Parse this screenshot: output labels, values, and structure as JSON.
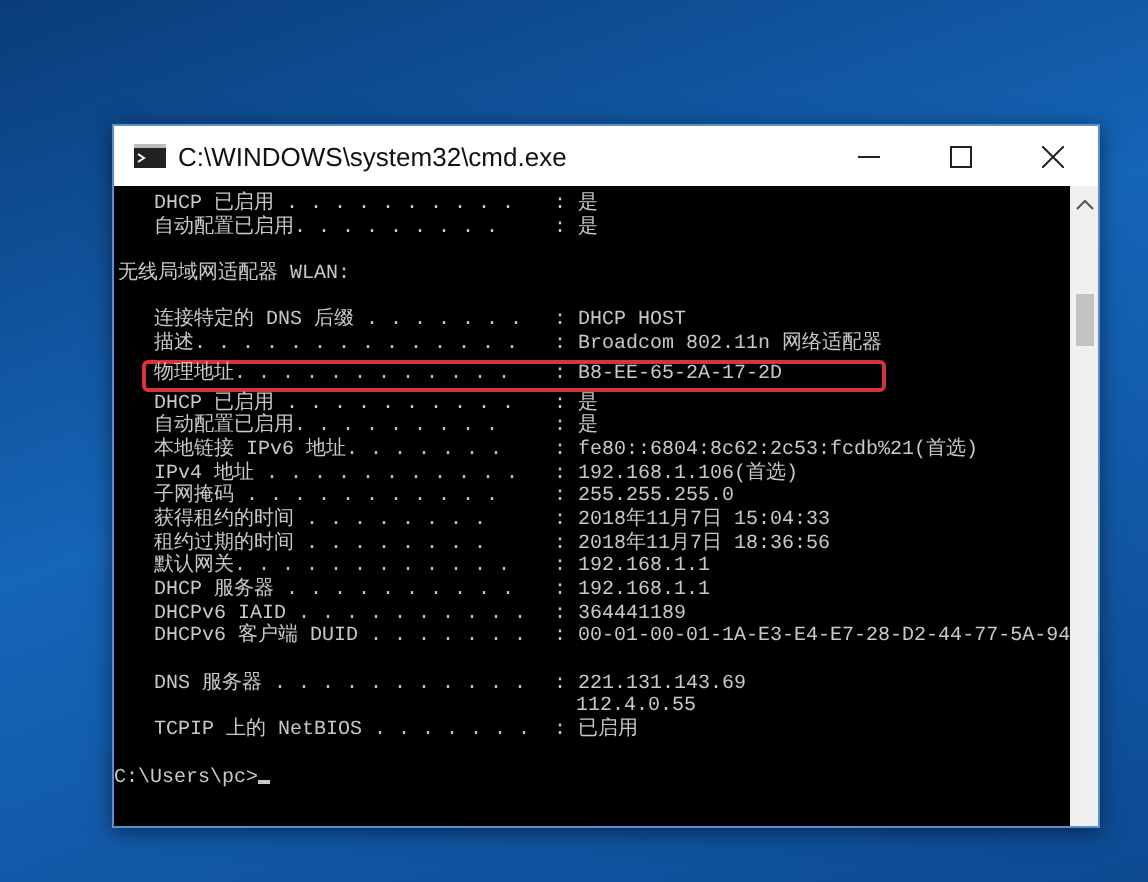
{
  "window": {
    "title": "C:\\WINDOWS\\system32\\cmd.exe"
  },
  "console": {
    "lines": [
      {
        "kind": "entry",
        "label": "DHCP 已启用 . . . . . . . . . .",
        "separator": ":",
        "value": "是"
      },
      {
        "kind": "entry",
        "label": "自动配置已启用. . . . . . . . .",
        "separator": ":",
        "value": "是"
      },
      {
        "kind": "blank"
      },
      {
        "kind": "heading",
        "text": "无线局域网适配器 WLAN:"
      },
      {
        "kind": "blank"
      },
      {
        "kind": "entry",
        "label": "连接特定的 DNS 后缀 . . . . . . .",
        "separator": ":",
        "value": "DHCP HOST"
      },
      {
        "kind": "entry",
        "label": "描述. . . . . . . . . . . . . .",
        "separator": ":",
        "value": "Broadcom 802.11n 网络适配器"
      },
      {
        "kind": "entry",
        "label": "物理地址. . . . . . . . . . . .",
        "separator": ":",
        "value": "B8-EE-65-2A-17-2D",
        "highlighted": true
      },
      {
        "kind": "entry",
        "label": "DHCP 已启用 . . . . . . . . . .",
        "separator": ":",
        "value": "是"
      },
      {
        "kind": "entry",
        "label": "自动配置已启用. . . . . . . . .",
        "separator": ":",
        "value": "是"
      },
      {
        "kind": "entry",
        "label": "本地链接 IPv6 地址. . . . . . .",
        "separator": ":",
        "value": "fe80::6804:8c62:2c53:fcdb%21(首选)"
      },
      {
        "kind": "entry",
        "label": "IPv4 地址 . . . . . . . . . . .",
        "separator": ":",
        "value": "192.168.1.106(首选)"
      },
      {
        "kind": "entry",
        "label": "子网掩码 . . . . . . . . . . .",
        "separator": ":",
        "value": "255.255.255.0"
      },
      {
        "kind": "entry",
        "label": "获得租约的时间 . . . . . . . .",
        "separator": ":",
        "value": "2018年11月7日 15:04:33"
      },
      {
        "kind": "entry",
        "label": "租约过期的时间 . . . . . . . .",
        "separator": ":",
        "value": "2018年11月7日 18:36:56"
      },
      {
        "kind": "entry",
        "label": "默认网关. . . . . . . . . . . .",
        "separator": ":",
        "value": "192.168.1.1"
      },
      {
        "kind": "entry",
        "label": "DHCP 服务器 . . . . . . . . . .",
        "separator": ":",
        "value": "192.168.1.1"
      },
      {
        "kind": "entry",
        "label": "DHCPv6 IAID . . . . . . . . . .",
        "separator": ":",
        "value": "364441189"
      },
      {
        "kind": "entry",
        "label": "DHCPv6 客户端 DUID . . . . . . .",
        "separator": ":",
        "value": "00-01-00-01-1A-E3-E4-E7-28-D2-44-77-5A-94"
      },
      {
        "kind": "blank"
      },
      {
        "kind": "entry",
        "label": "DNS 服务器 . . . . . . . . . . .",
        "separator": ":",
        "value": "221.131.143.69"
      },
      {
        "kind": "continuation",
        "value": "112.4.0.55"
      },
      {
        "kind": "entry",
        "label": "TCPIP 上的 NetBIOS . . . . . . .",
        "separator": ":",
        "value": "已启用"
      },
      {
        "kind": "blank"
      },
      {
        "kind": "prompt",
        "text": "C:\\Users\\pc>"
      }
    ]
  }
}
